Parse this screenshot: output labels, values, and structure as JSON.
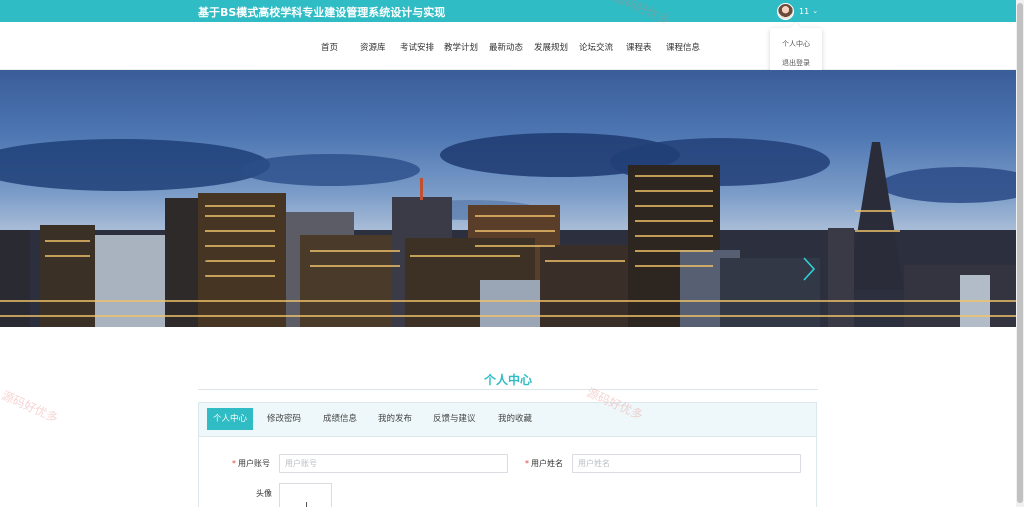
{
  "header": {
    "site_title": "基于BS模式高校学科专业建设管理系统设计与实现",
    "user": {
      "name": "11"
    }
  },
  "user_menu": {
    "items": [
      "个人中心",
      "退出登录"
    ]
  },
  "nav": {
    "items": [
      "首页",
      "资源库",
      "考试安排",
      "教学计划",
      "最新动态",
      "发展规划",
      "论坛交流",
      "课程表",
      "课程信息"
    ]
  },
  "section": {
    "title": "个人中心"
  },
  "tabs": [
    "个人中心",
    "修改密码",
    "成绩信息",
    "我的发布",
    "反馈与建议",
    "我的收藏"
  ],
  "form": {
    "required_mark": "*",
    "account": {
      "label": "用户账号",
      "placeholder": "用户账号"
    },
    "name": {
      "label": "用户姓名",
      "placeholder": "用户姓名"
    },
    "avatar": {
      "label": "头像"
    }
  },
  "watermark": "源码好优多",
  "colors": {
    "accent": "#2fbcc4",
    "required": "#e0453a"
  }
}
